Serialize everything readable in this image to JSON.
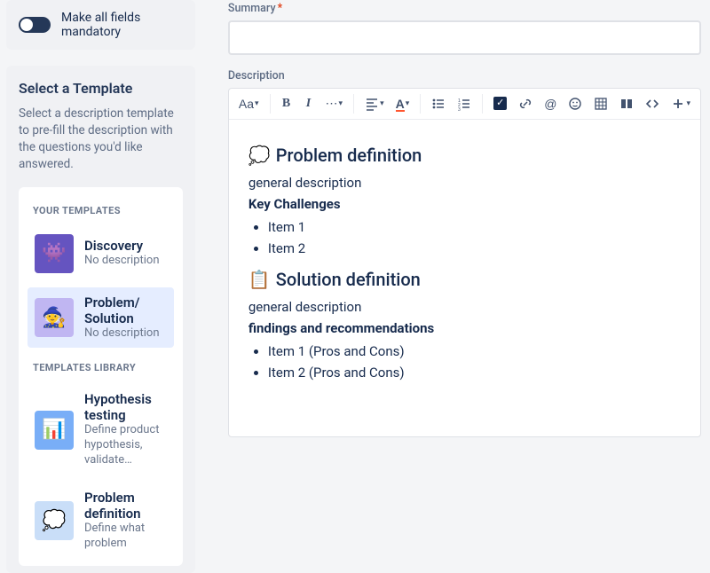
{
  "toggle": {
    "label": "Make all fields mandatory",
    "on": false
  },
  "templatePanel": {
    "title": "Select a Template",
    "subtitle": "Select a description template to pre-fill the description with the questions you'd like answered.",
    "sections": {
      "yours": {
        "label": "YOUR TEMPLATES",
        "items": [
          {
            "name": "Discovery",
            "desc": "No description",
            "iconBg": "#6554c0",
            "emoji": "👾",
            "selected": false
          },
          {
            "name": "Problem/ Solution",
            "desc": "No description",
            "iconBg": "#c0b6f2",
            "emoji": "🧙",
            "selected": true
          }
        ]
      },
      "library": {
        "label": "TEMPLATES LIBRARY",
        "items": [
          {
            "name": "Hypothesis testing",
            "desc": "Define product hypothesis, validate…",
            "iconBg": "#79aef7",
            "emoji": "📊",
            "selected": false
          },
          {
            "name": "Problem definition",
            "desc": "Define what problem",
            "iconBg": "#c9def8",
            "emoji": "💭",
            "selected": false
          }
        ]
      }
    }
  },
  "form": {
    "summaryLabel": "Summary",
    "summaryValue": "",
    "descriptionLabel": "Description"
  },
  "toolbar": {
    "textStyle": "Aa"
  },
  "doc": {
    "s1": {
      "emoji": "💭",
      "title": "Problem definition",
      "p": "general description",
      "sub": "Key Challenges",
      "items": [
        "Item 1",
        "Item 2"
      ]
    },
    "s2": {
      "emoji": "📋",
      "title": "Solution definition",
      "p": "general description",
      "sub": "findings and recommendations",
      "items": [
        "Item 1 (Pros and Cons)",
        "Item 2 (Pros and Cons)"
      ]
    }
  }
}
